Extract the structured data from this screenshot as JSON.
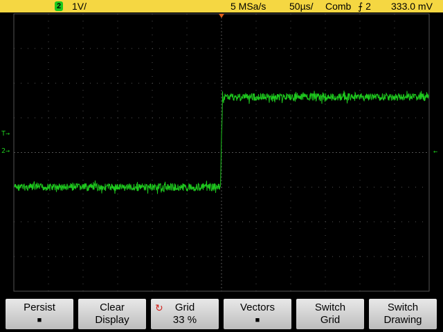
{
  "status": {
    "channel_number": "2",
    "volts_per_div": "1V/",
    "sample_rate": "5 MSa/s",
    "time_per_div": "50µs/",
    "trigger_mode": "Comb",
    "trigger_source": "⨍ 2",
    "trigger_level": "333.0 mV"
  },
  "markers": {
    "trigger_left": "T→",
    "channel_left": "2→",
    "level_right": "←"
  },
  "colors": {
    "status_bar": "#f5d742",
    "trace": "#1ec81e",
    "grid": "#555555",
    "trigger_marker": "#e0601a"
  },
  "trace": {
    "low_level_div": -1.0,
    "high_level_div": 1.6,
    "edge_time_div": 0.0,
    "noise_div": 0.22
  },
  "softkeys": [
    {
      "line1": "Persist",
      "line2": "■"
    },
    {
      "line1": "Clear",
      "line2": "Display"
    },
    {
      "line1": "Grid",
      "line2": "33 %",
      "icon": "rotate-knob-icon"
    },
    {
      "line1": "Vectors",
      "line2": "■"
    },
    {
      "line1": "Switch",
      "line2": "Grid"
    },
    {
      "line1": "Switch",
      "line2": "Drawing"
    }
  ]
}
